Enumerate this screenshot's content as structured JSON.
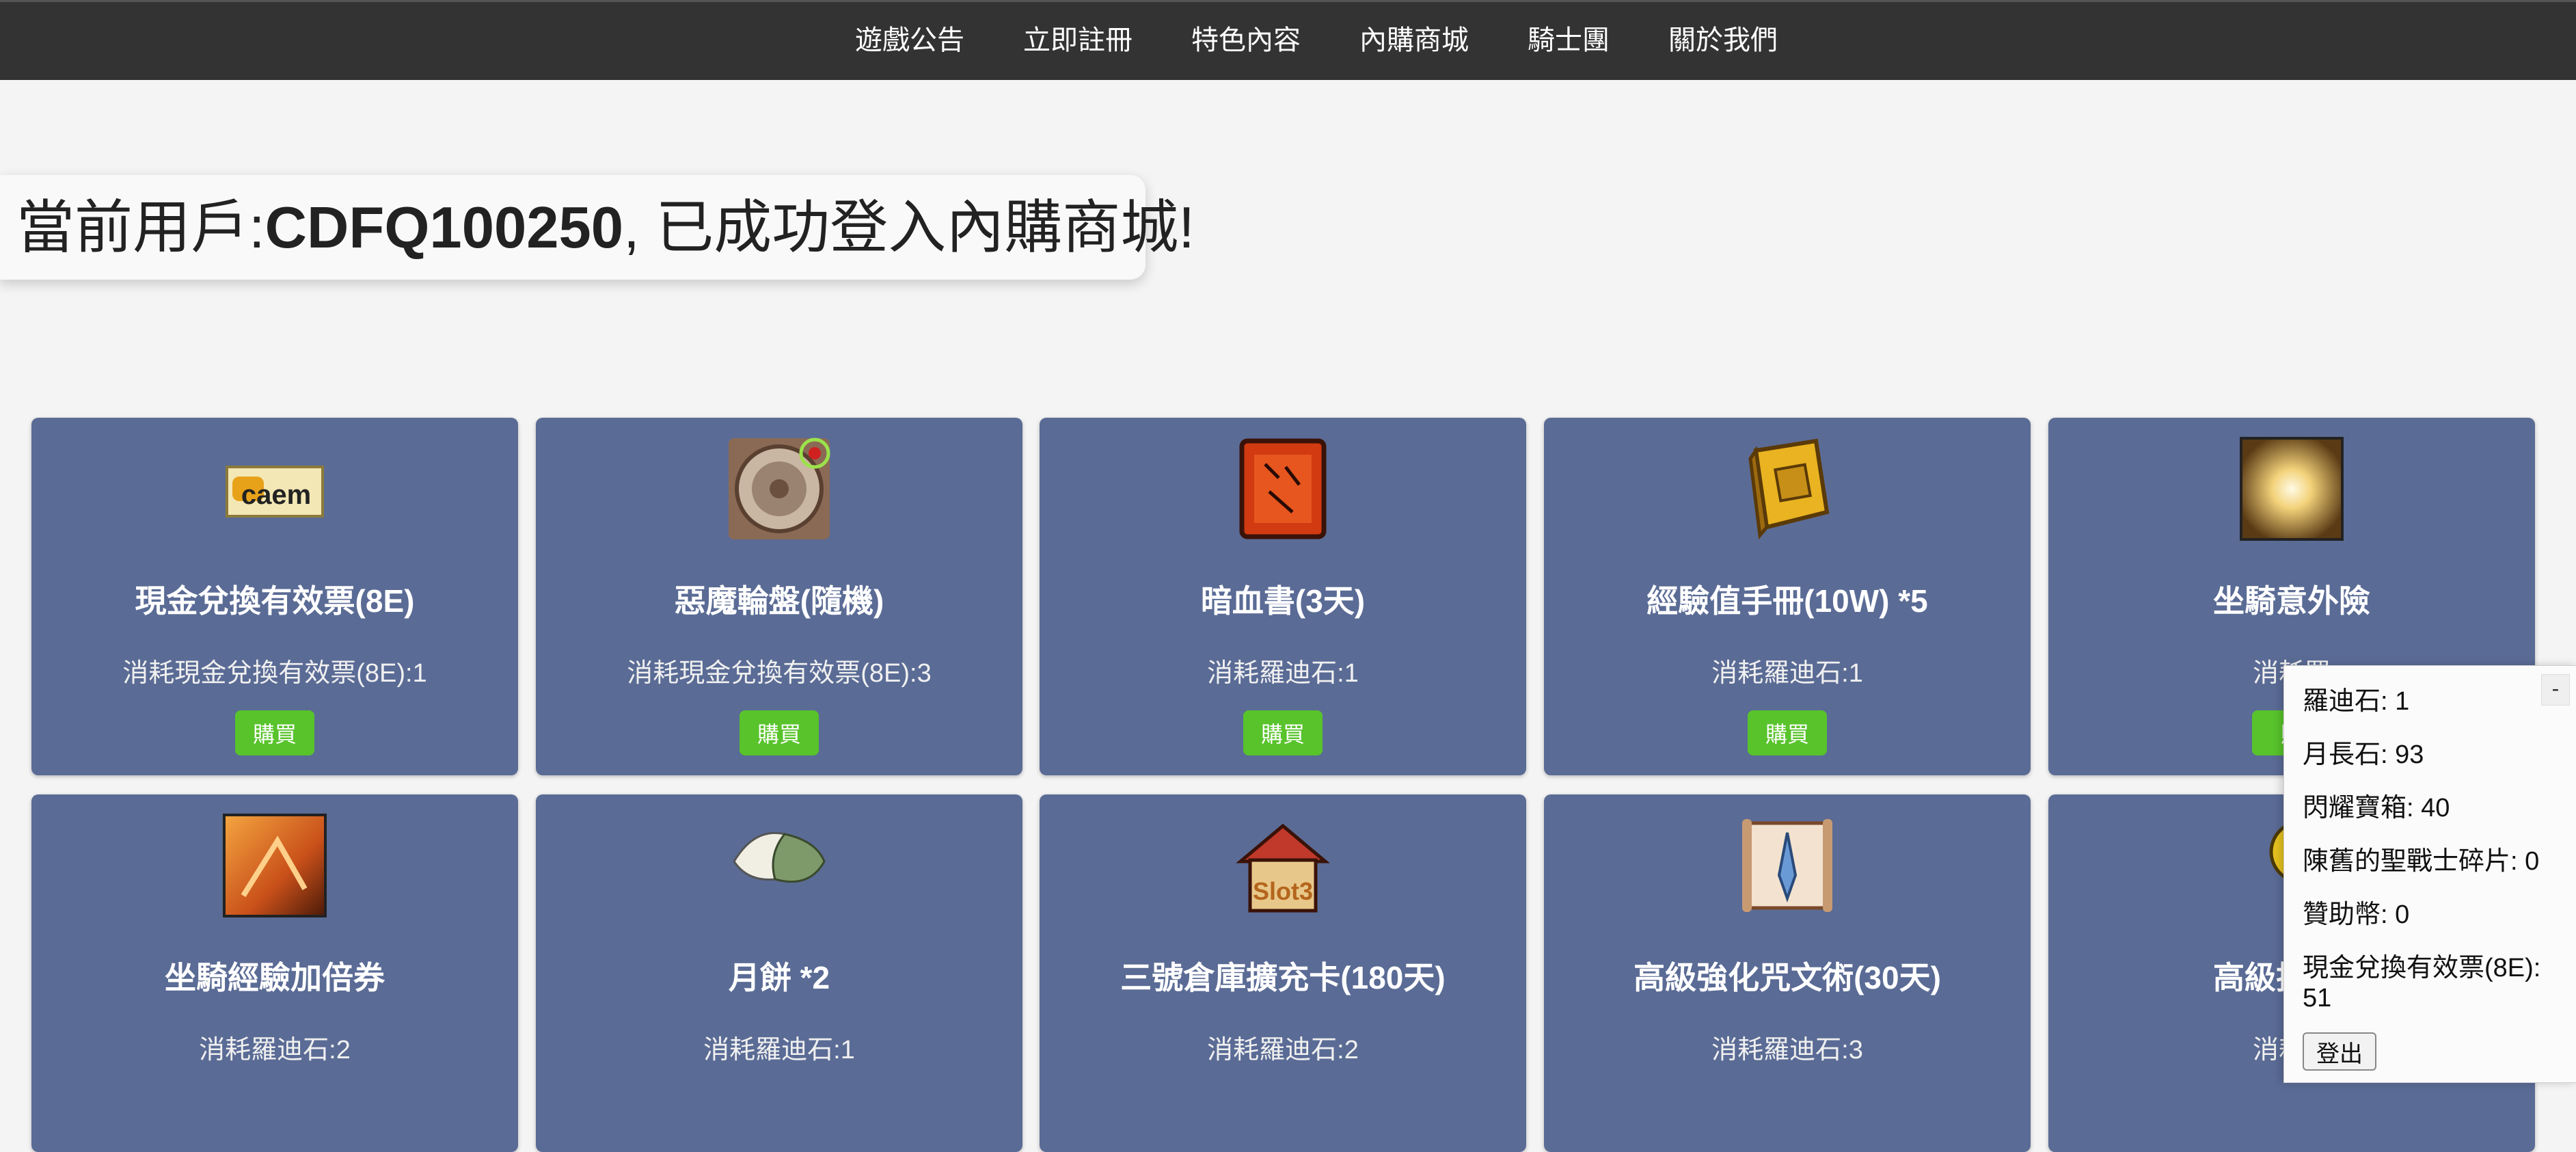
{
  "nav": {
    "items": [
      {
        "label": "遊戲公告"
      },
      {
        "label": "立即註冊"
      },
      {
        "label": "特色內容"
      },
      {
        "label": "內購商城"
      },
      {
        "label": "騎士團"
      },
      {
        "label": "關於我們"
      }
    ]
  },
  "welcome": {
    "prefix": "當前用戶:",
    "user_id": "CDFQ100250",
    "suffix": ", 已成功登入內購商城!"
  },
  "items": [
    {
      "name": "現金兌換有效票(8E)",
      "cost": "消耗現金兌換有效票(8E):1",
      "buy_label": "購買",
      "icon": "cash-ticket-icon"
    },
    {
      "name": "惡魔輪盤(隨機)",
      "cost": "消耗現金兌換有效票(8E):3",
      "buy_label": "購買",
      "icon": "demon-roulette-icon"
    },
    {
      "name": "暗血書(3天)",
      "cost": "消耗羅迪石:1",
      "buy_label": "購買",
      "icon": "dark-blood-book-icon"
    },
    {
      "name": "經驗值手冊(10W) *5",
      "cost": "消耗羅迪石:1",
      "buy_label": "購買",
      "icon": "exp-manual-icon"
    },
    {
      "name": "坐騎意外險",
      "cost": "消耗羅",
      "buy_label": "購",
      "icon": "mount-insurance-icon"
    },
    {
      "name": "坐騎經驗加倍券",
      "cost": "消耗羅迪石:2",
      "icon": "mount-exp-coupon-icon"
    },
    {
      "name": "月餅 *2",
      "cost": "消耗羅迪石:1",
      "icon": "mooncake-icon"
    },
    {
      "name": "三號倉庫擴充卡(180天)",
      "cost": "消耗羅迪石:2",
      "icon": "storage-slot3-icon"
    },
    {
      "name": "高級強化咒文術(30天)",
      "cost": "消耗羅迪石:3",
      "icon": "enhance-scroll-icon"
    },
    {
      "name": "高級技能精",
      "cost": "消耗羅",
      "icon": "skill-item-icon"
    }
  ],
  "panel": {
    "collapse_label": "-",
    "rows": [
      "羅迪石: 1",
      "月長石: 93",
      "閃耀寶箱: 40",
      "陳舊的聖戰士碎片: 0",
      "贊助幣: 0",
      "現金兌換有效票(8E):",
      "51"
    ],
    "logout_label": "登出"
  },
  "colors": {
    "topbar": "#333333",
    "card": "#5a6b95",
    "buy_button": "#58c32b",
    "page_background": "#f4f4f4"
  }
}
